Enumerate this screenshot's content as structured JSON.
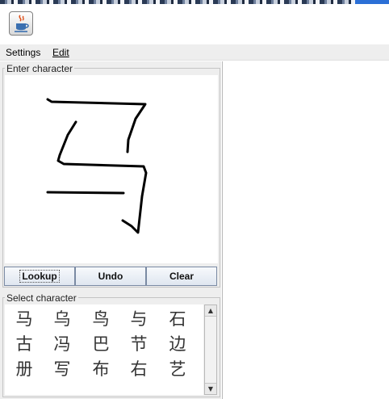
{
  "window": {
    "icon": "java-app-icon"
  },
  "menu": {
    "settings": "Settings",
    "edit": "Edit"
  },
  "enter_panel": {
    "title": "Enter character"
  },
  "buttons": {
    "lookup": "Lookup",
    "undo": "Undo",
    "clear": "Clear"
  },
  "select_panel": {
    "title": "Select character",
    "characters": [
      "马",
      "乌",
      "鸟",
      "与",
      "石",
      "古",
      "冯",
      "巴",
      "节",
      "边",
      "册",
      "写",
      "布",
      "右",
      "艺"
    ]
  },
  "scrollbar": {
    "up_icon": "arrow-up-icon",
    "down_icon": "arrow-down-icon"
  }
}
